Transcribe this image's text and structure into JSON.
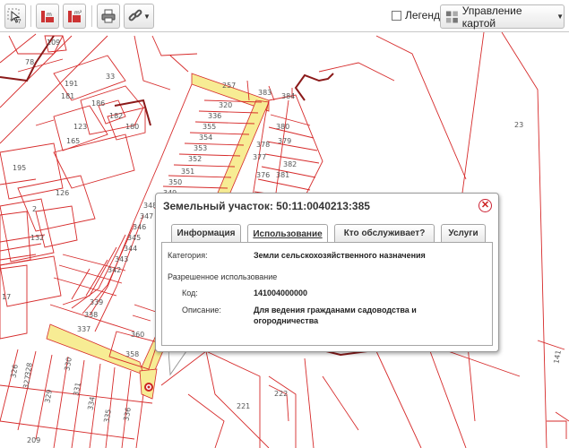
{
  "toolbar": {
    "legend_label": "Легенда",
    "map_control_label": "Управление картой"
  },
  "map": {
    "parcel_labels": [
      "109",
      "78",
      "33",
      "191",
      "181",
      "186",
      "182",
      "123",
      "180",
      "165",
      "195",
      "126",
      "2",
      "132",
      "257",
      "383",
      "384",
      "320",
      "380",
      "336",
      "355",
      "379",
      "354",
      "378",
      "353",
      "382",
      "352",
      "377",
      "351",
      "381",
      "376",
      "350",
      "349",
      "348",
      "347",
      "346",
      "345",
      "344",
      "343",
      "342",
      "339",
      "338",
      "337",
      "360",
      "358",
      "330",
      "329",
      "328",
      "327",
      "326",
      "331",
      "334",
      "335",
      "336",
      "222",
      "221",
      "209",
      "23",
      "17",
      "141"
    ]
  },
  "popup": {
    "title": "Земельный участок: 50:11:0040213:385",
    "tabs": [
      {
        "label": "Информация"
      },
      {
        "label": "Использование"
      },
      {
        "label": "Кто обслуживает?"
      },
      {
        "label": "Услуги"
      }
    ],
    "active_tab": "Использование",
    "category_label": "Категория:",
    "category_value": "Земли сельскохозяйственного назначения",
    "permitted_use_heading": "Разрешенное использование",
    "code_label": "Код:",
    "code_value": "141004000000",
    "description_label": "Описание:",
    "description_value": "Для ведения гражданами садоводства и огородничества"
  },
  "colors": {
    "parcel_line": "#d62a2a",
    "road_fill": "#f7ec94",
    "accent_close": "#cc2222"
  }
}
